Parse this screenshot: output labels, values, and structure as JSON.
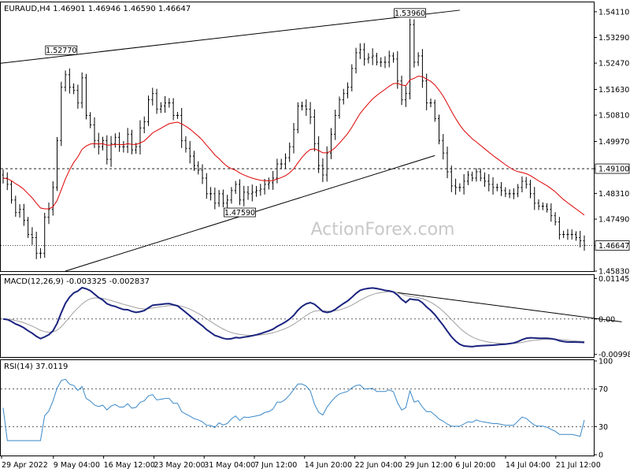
{
  "chart_data": [
    {
      "type": "ohlc",
      "panel": "price",
      "header": "EURAUD,H4  1.46901 1.46946 1.46590 1.46647",
      "symbol": "EURAUD",
      "timeframe": "H4",
      "last_ohlc": {
        "open": 1.46901,
        "high": 1.46946,
        "low": 1.4659,
        "close": 1.46647
      },
      "ylim": [
        1.4583,
        1.5441
      ],
      "y_ticks": [
        "1.54110",
        "1.53290",
        "1.52470",
        "1.51630",
        "1.50810",
        "1.49970",
        "1.49100",
        "1.48310",
        "1.47490",
        "1.46647",
        "1.45830"
      ],
      "x_tick_labels": [
        "29 Apr 2022",
        "9 May 04:00",
        "16 May 12:00",
        "23 May 20:00",
        "31 May 04:00",
        "7 Jun 12:00",
        "14 Jun 20:00",
        "22 Jun 04:00",
        "29 Jun 12:00",
        "6 Jul 20:00",
        "14 Jul 04:00",
        "21 Jul 12:00"
      ],
      "horizontal_levels": [
        {
          "value": 1.491,
          "label": "1.49100"
        },
        {
          "value": 1.46647,
          "label": "1.46647"
        }
      ],
      "annotations": [
        {
          "label": "1.52770",
          "value": 1.5277,
          "x_index": 14
        },
        {
          "label": "1.53960",
          "value": 1.5396,
          "x_index": 98
        },
        {
          "label": "1.47590",
          "value": 1.4759,
          "x_index": 57
        }
      ],
      "trendlines": [
        {
          "from": {
            "x_index": -1,
            "value": 1.5246
          },
          "to": {
            "x_index": 110,
            "value": 1.5416
          }
        },
        {
          "from": {
            "x_index": 15,
            "value": 1.4583
          },
          "to": {
            "x_index": 104,
            "value": 1.4952
          }
        }
      ],
      "moving_average": {
        "color": "#dd0000"
      },
      "closes": [
        1.488,
        1.486,
        1.481,
        1.477,
        1.478,
        1.4745,
        1.47,
        1.469,
        1.464,
        1.464,
        1.4755,
        1.478,
        1.485,
        1.5,
        1.517,
        1.521,
        1.517,
        1.516,
        1.512,
        1.52,
        1.508,
        1.505,
        1.5,
        1.498,
        1.5,
        1.494,
        1.499,
        1.501,
        1.498,
        1.498,
        1.502,
        1.497,
        1.498,
        1.504,
        1.506,
        1.513,
        1.515,
        1.51,
        1.511,
        1.512,
        1.512,
        1.508,
        1.508,
        1.5,
        1.4975,
        1.495,
        1.492,
        1.4905,
        1.488,
        1.483,
        1.483,
        1.48,
        1.483,
        1.48,
        1.481,
        1.484,
        1.486,
        1.481,
        1.4835,
        1.483,
        1.4835,
        1.484,
        1.4845,
        1.486,
        1.4865,
        1.488,
        1.4925,
        1.4925,
        1.4945,
        1.498,
        1.5035,
        1.511,
        1.511,
        1.51,
        1.5075,
        1.499,
        1.492,
        1.489,
        1.496,
        1.502,
        1.508,
        1.513,
        1.515,
        1.517,
        1.523,
        1.528,
        1.529,
        1.526,
        1.5265,
        1.527,
        1.525,
        1.525,
        1.525,
        1.527,
        1.526,
        1.519,
        1.513,
        1.515,
        1.537,
        1.525,
        1.527,
        1.519,
        1.512,
        1.512,
        1.507,
        1.5,
        1.496,
        1.49,
        1.4855,
        1.485,
        1.485,
        1.487,
        1.489,
        1.488,
        1.49,
        1.488,
        1.487,
        1.486,
        1.485,
        1.485,
        1.484,
        1.483,
        1.483,
        1.483,
        1.485,
        1.487,
        1.486,
        1.483,
        1.48,
        1.479,
        1.479,
        1.478,
        1.476,
        1.474,
        1.47,
        1.47,
        1.47,
        1.47,
        1.469,
        1.468,
        1.4665
      ]
    },
    {
      "type": "line",
      "panel": "macd",
      "header": "MACD(12,26,9) -0.003325 -0.002837",
      "main_value": -0.003325,
      "signal_value": -0.002837,
      "ylim": [
        -0.0105,
        0.0122
      ],
      "y_ticks": [
        "0.01145",
        "0.00",
        "-0.009985"
      ],
      "main_color": "#1a237e",
      "signal_color": "#a0a0a0",
      "trendline": {
        "from": {
          "x_index": 95,
          "value": 0.00745
        },
        "to": {
          "x_index": 149,
          "value": -0.0008
        }
      }
    },
    {
      "type": "line",
      "panel": "rsi",
      "header": "RSI(14) 37.0119",
      "value": 37.0119,
      "ylim": [
        0,
        100
      ],
      "y_ticks": [
        "100",
        "70",
        "30",
        "0"
      ],
      "levels": [
        70,
        30
      ],
      "color": "#3a88c8"
    }
  ],
  "watermark": "ActionForex.com"
}
